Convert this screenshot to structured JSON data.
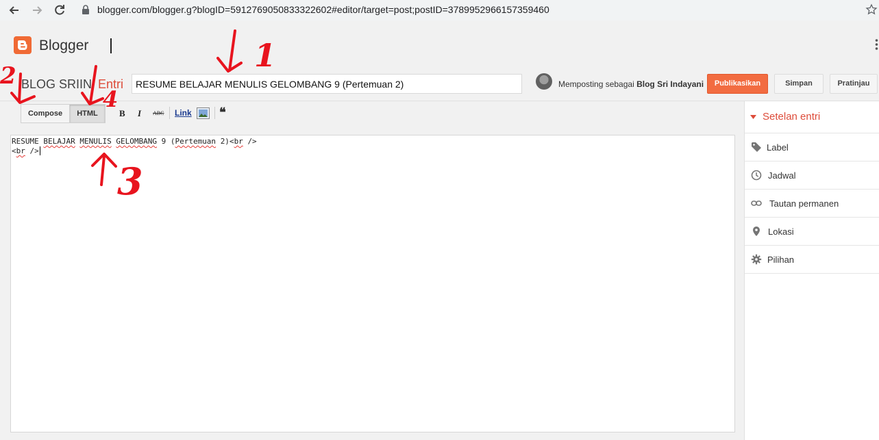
{
  "browser": {
    "url": "blogger.com/blogger.g?blogID=5912769050833322602#editor/target=post;postID=3789952966157359460"
  },
  "header": {
    "logo_text": "Blogger"
  },
  "post": {
    "blog_name": "BLOG SRIIN",
    "section": "Entri",
    "title_value": "RESUME BELAJAR MENULIS GELOMBANG 9 (Pertemuan 2)",
    "posting_as_prefix": "Memposting sebagai",
    "posting_as_name": "Blog Sri Indayani",
    "publish_label": "Publikasikan",
    "save_label": "Simpan",
    "preview_label": "Pratinjau"
  },
  "toolbar": {
    "compose_label": "Compose",
    "html_label": "HTML",
    "bold_label": "B",
    "italic_label": "I",
    "strike_label": "ABC",
    "link_label": "Link",
    "quote_label": "❝"
  },
  "editor": {
    "line1_words": [
      "RESUME",
      "BELAJAR",
      "MENULIS",
      "GELOMBANG",
      "9",
      "(",
      "Pertemuan",
      "2)<",
      "br",
      "/>"
    ],
    "line2_words": [
      "<",
      "br",
      "/>"
    ]
  },
  "sidebar": {
    "heading": "Setelan entri",
    "items": [
      {
        "label": "Label",
        "icon": "tag-icon"
      },
      {
        "label": "Jadwal",
        "icon": "clock-icon"
      },
      {
        "label": "Tautan permanen",
        "icon": "link-icon"
      },
      {
        "label": "Lokasi",
        "icon": "location-pin-icon"
      },
      {
        "label": "Pilihan",
        "icon": "gear-icon"
      }
    ]
  },
  "annotations": [
    "1",
    "2",
    "3",
    "4"
  ],
  "colors": {
    "accent": "#dd4b39",
    "publish": "#f26c41",
    "annotation": "#e8141e"
  }
}
